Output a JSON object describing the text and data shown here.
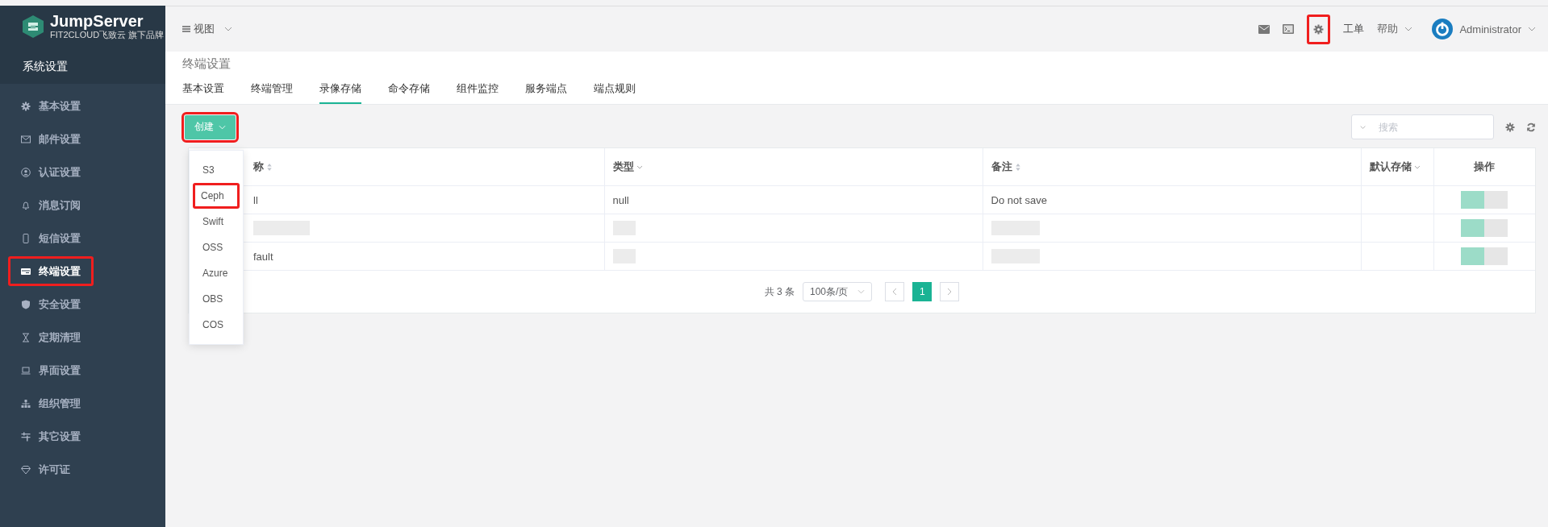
{
  "sidebar": {
    "brand": "JumpServer",
    "tagline": "FIT2CLOUD飞致云 旗下品牌",
    "section": "系统设置",
    "items": [
      {
        "label": "基本设置",
        "selected": false,
        "highlighted": false
      },
      {
        "label": "邮件设置",
        "selected": false,
        "highlighted": false
      },
      {
        "label": "认证设置",
        "selected": false,
        "highlighted": false
      },
      {
        "label": "消息订阅",
        "selected": false,
        "highlighted": false
      },
      {
        "label": "短信设置",
        "selected": false,
        "highlighted": false
      },
      {
        "label": "终端设置",
        "selected": true,
        "highlighted": true
      },
      {
        "label": "安全设置",
        "selected": false,
        "highlighted": false
      },
      {
        "label": "定期清理",
        "selected": false,
        "highlighted": false
      },
      {
        "label": "界面设置",
        "selected": false,
        "highlighted": false
      },
      {
        "label": "组织管理",
        "selected": false,
        "highlighted": false
      },
      {
        "label": "其它设置",
        "selected": false,
        "highlighted": false
      },
      {
        "label": "许可证",
        "selected": false,
        "highlighted": false
      }
    ]
  },
  "topbar": {
    "view_label": "视图",
    "settings_highlighted": true,
    "ticket": "工单",
    "help": "帮助",
    "user": "Administrator"
  },
  "page": {
    "title": "终端设置",
    "tabs": [
      {
        "label": "基本设置",
        "selected": false
      },
      {
        "label": "终端管理",
        "selected": false
      },
      {
        "label": "录像存储",
        "selected": true
      },
      {
        "label": "命令存储",
        "selected": false
      },
      {
        "label": "组件监控",
        "selected": false
      },
      {
        "label": "服务端点",
        "selected": false
      },
      {
        "label": "端点规则",
        "selected": false
      }
    ]
  },
  "toolbar": {
    "create": {
      "label": "创建",
      "highlighted": true
    },
    "search": {
      "placeholder": "搜索"
    }
  },
  "create_menu": [
    {
      "label": "S3",
      "highlighted": false
    },
    {
      "label": "Ceph",
      "highlighted": true
    },
    {
      "label": "Swift",
      "highlighted": false
    },
    {
      "label": "OSS",
      "highlighted": false
    },
    {
      "label": "Azure",
      "highlighted": false
    },
    {
      "label": "OBS",
      "highlighted": false
    },
    {
      "label": "COS",
      "highlighted": false
    }
  ],
  "table": {
    "columns": [
      {
        "label": "称",
        "kind": "sort"
      },
      {
        "label": "类型",
        "kind": "filter"
      },
      {
        "label": "备注",
        "kind": "sort"
      },
      {
        "label": "默认存储",
        "kind": "filter"
      },
      {
        "label": "操作",
        "kind": "plain"
      }
    ],
    "rows": [
      {
        "name": "ll",
        "type": "null",
        "comment": "Do not save"
      },
      {
        "redacted": true
      },
      {
        "name": "fault",
        "redacted": true
      }
    ]
  },
  "pagination": {
    "total": "共 3 条",
    "page_size": "100条/页",
    "pages": [
      {
        "label": "1",
        "selected": true
      }
    ]
  }
}
